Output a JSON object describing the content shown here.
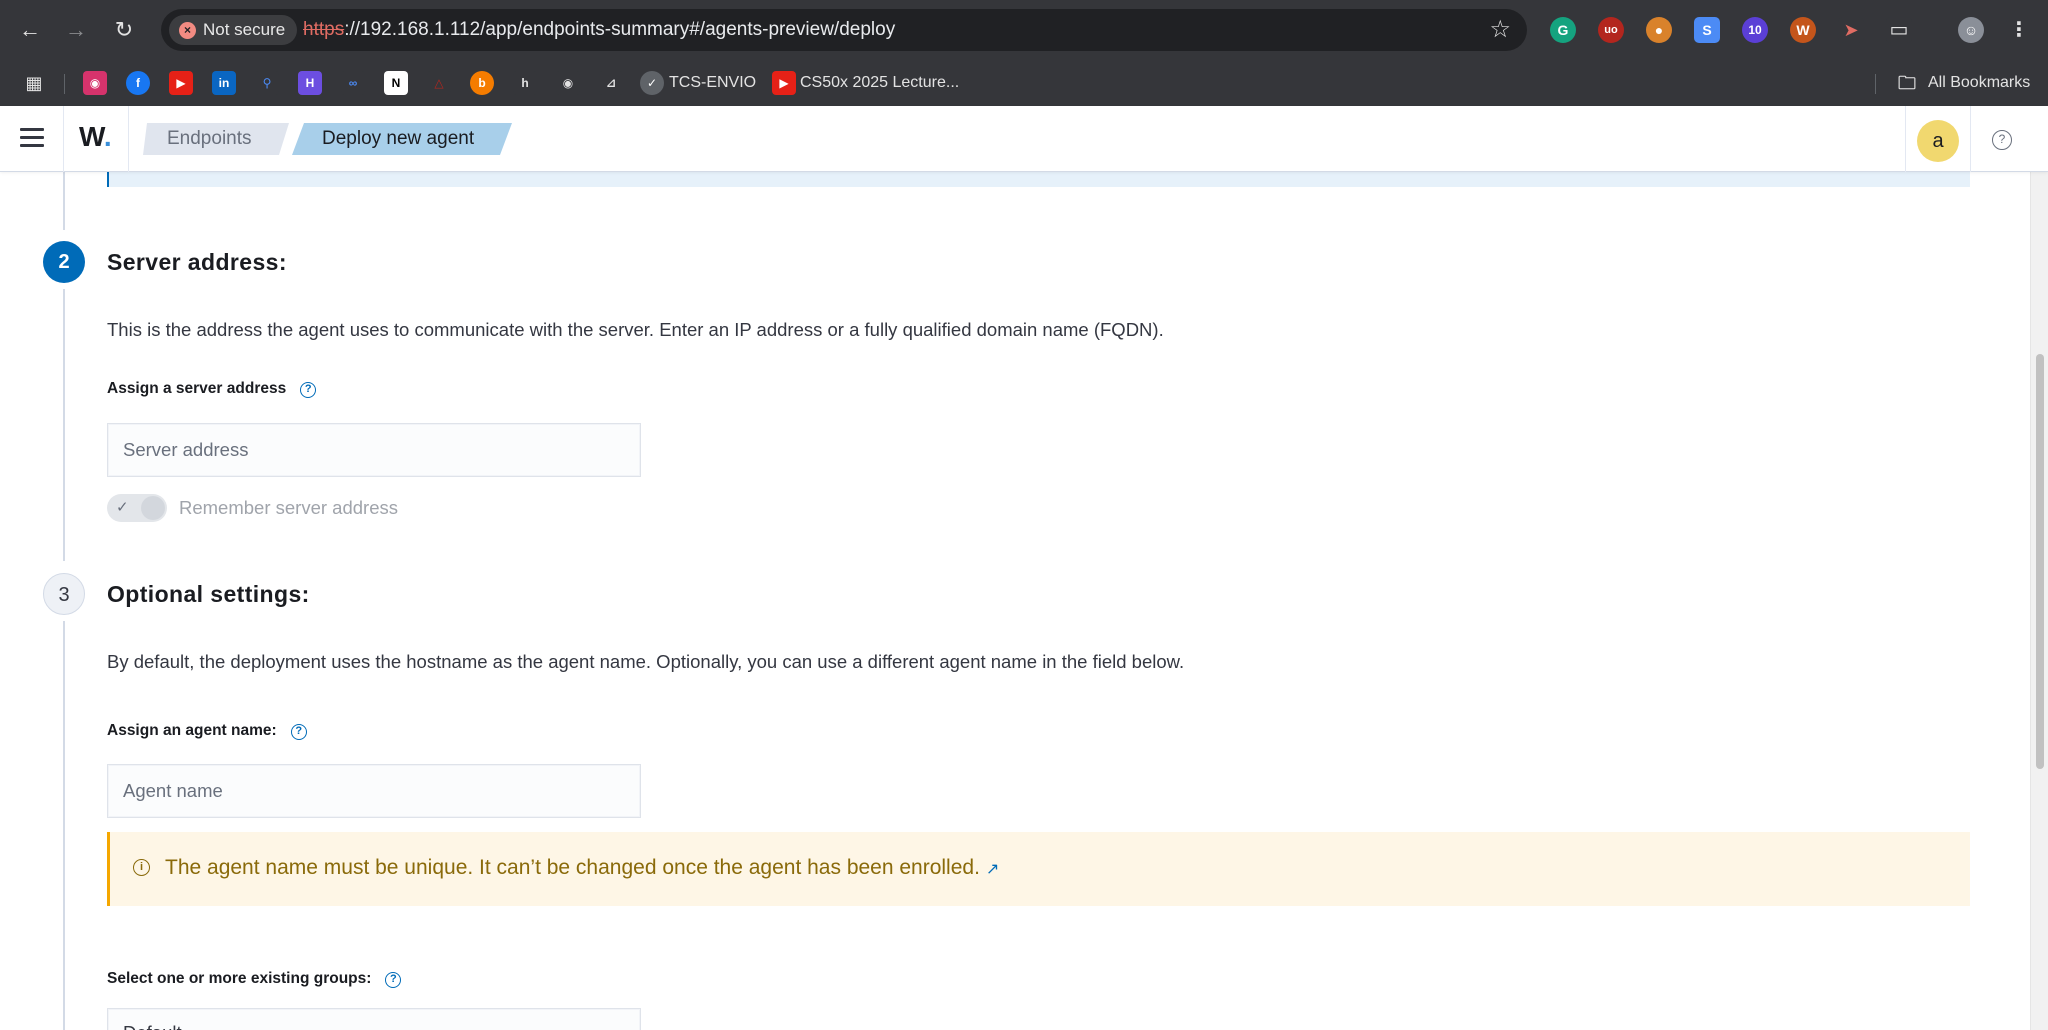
{
  "browser": {
    "security_chip": "Not secure",
    "url_scheme": "https",
    "url_rest": "://192.168.1.112/app/endpoints-summary#/agents-preview/deploy",
    "bookmarks": [
      {
        "label": "TCS-ENVIO"
      },
      {
        "label": "CS50x 2025 Lecture..."
      }
    ],
    "all_bookmarks": "All Bookmarks",
    "ext_badge": "10"
  },
  "header": {
    "logo": "W",
    "logo_dot": ".",
    "breadcrumbs": [
      "Endpoints",
      "Deploy new agent"
    ],
    "avatar": "a",
    "help": "?"
  },
  "steps": {
    "server": {
      "number": "2",
      "title": "Server address:",
      "description": "This is the address the agent uses to communicate with the server. Enter an IP address or a fully qualified domain name (FQDN).",
      "field_label": "Assign a server address",
      "placeholder": "Server address",
      "toggle_label": "Remember server address"
    },
    "optional": {
      "number": "3",
      "title": "Optional settings:",
      "description": "By default, the deployment uses the hostname as the agent name. Optionally, you can use a different agent name in the field below.",
      "name_label": "Assign an agent name:",
      "name_placeholder": "Agent name",
      "warning": "The agent name must be unique. It can’t be changed once the agent has been enrolled.",
      "groups_label": "Select one or more existing groups:",
      "groups_value": "Default"
    }
  },
  "colors": {
    "primary": "#006bb8",
    "warning_bg": "#fef6e6",
    "warning_text": "#8a6a0a",
    "chrome_bg": "#35363a"
  }
}
